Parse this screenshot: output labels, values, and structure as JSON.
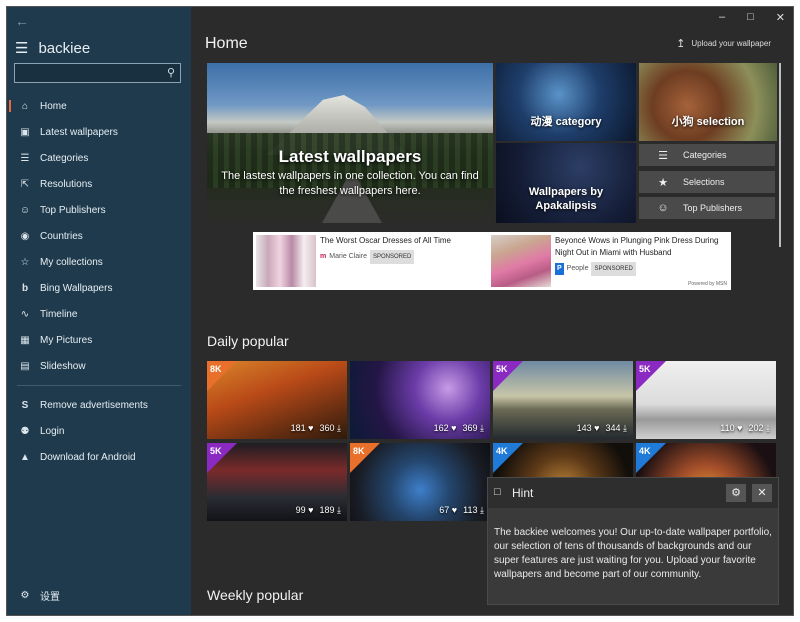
{
  "app": {
    "name": "backiee",
    "page_title": "Home",
    "upload_label": "Upload your wallpaper"
  },
  "search": {
    "placeholder": ""
  },
  "sidebar": {
    "items": [
      {
        "label": "Home",
        "icon": "home-icon"
      },
      {
        "label": "Latest wallpapers",
        "icon": "image-icon"
      },
      {
        "label": "Categories",
        "icon": "list-icon"
      },
      {
        "label": "Resolutions",
        "icon": "resize-icon"
      },
      {
        "label": "Top Publishers",
        "icon": "people-icon"
      },
      {
        "label": "Countries",
        "icon": "globe-icon"
      },
      {
        "label": "My collections",
        "icon": "star-icon"
      },
      {
        "label": "Bing Wallpapers",
        "icon": "bing-icon"
      },
      {
        "label": "Timeline",
        "icon": "timeline-icon"
      },
      {
        "label": "My Pictures",
        "icon": "picture-icon"
      },
      {
        "label": "Slideshow",
        "icon": "slideshow-icon"
      }
    ],
    "extra": [
      {
        "label": "Remove advertisements",
        "icon": "dollar-icon"
      },
      {
        "label": "Login",
        "icon": "user-icon"
      },
      {
        "label": "Download for Android",
        "icon": "android-icon"
      }
    ],
    "settings_label": "设置"
  },
  "hero": {
    "title": "Latest wallpapers",
    "subtitle": "The lastest wallpapers in one collection. You can find the freshest wallpapers here."
  },
  "tiles": {
    "anime": "动漫 category",
    "puppy": "小狗 selection",
    "wallpaper_by": "Wallpapers by Apakalipsis"
  },
  "quick_links": [
    {
      "label": "Categories",
      "icon": "list-icon"
    },
    {
      "label": "Selections",
      "icon": "star-icon"
    },
    {
      "label": "Top Publishers",
      "icon": "people-icon"
    }
  ],
  "ad": {
    "items": [
      {
        "title": "The Worst Oscar Dresses of All Time",
        "source": "Marie Claire",
        "badge": "SPONSORED"
      },
      {
        "title": "Beyoncé Wows in Plunging Pink Dress During Night Out in Miami with Husband",
        "source": "People",
        "badge": "SPONSORED"
      }
    ],
    "powered": "Powered by MSN"
  },
  "sections": {
    "daily": "Daily popular",
    "weekly": "Weekly popular"
  },
  "daily_popular": [
    {
      "badge": "8K",
      "badge_color": "#e8702a",
      "likes": "181",
      "downloads": "360",
      "bg": "linear-gradient(160deg,#d9862a,#b94a18 40%,#5b2a10 80%,#2f1a0c)"
    },
    {
      "badge": "",
      "badge_color": "",
      "likes": "162",
      "downloads": "369",
      "bg": "radial-gradient(circle at 70% 35%,#c79be6 0%,#6b3ca8 30%,#241646 65%,#0c1a36 100%)"
    },
    {
      "badge": "5K",
      "badge_color": "#8b2ac2",
      "likes": "143",
      "downloads": "344",
      "bg": "linear-gradient(180deg,#6f8aa3 0%,#c8c6a8 45%,#6b6a55 62%,#242a2f 100%)"
    },
    {
      "badge": "5K",
      "badge_color": "#8b2ac2",
      "likes": "110",
      "downloads": "202",
      "bg": "linear-gradient(180deg,#f0f0f0 0%,#dcdcdc 55%,#9a9a9a 75%,#cfcfcf 100%)"
    },
    {
      "badge": "5K",
      "badge_color": "#8b2ac2",
      "likes": "99",
      "downloads": "189",
      "bg": "linear-gradient(180deg,#1d1d22 0%,#7a2a2a 35%,#2a2c33 70%,#121318 100%)"
    },
    {
      "badge": "8K",
      "badge_color": "#e8702a",
      "likes": "67",
      "downloads": "113",
      "bg": "radial-gradient(circle at 50% 60%,#3e7fc9 0%,#24466e 35%,#191c24 75%,#0d0f14 100%)"
    },
    {
      "badge": "4K",
      "badge_color": "#1f7ad8",
      "likes": "",
      "downloads": "",
      "bg": "radial-gradient(circle at 50% 60%,#c28a3a 0%,#5e3a18 40%,#120e0a 80%)"
    },
    {
      "badge": "4K",
      "badge_color": "#1f7ad8",
      "likes": "",
      "downloads": "",
      "bg": "radial-gradient(circle at 50% 70%,#e3a330 0%,#a7502a 35%,#1a0f12 80%)"
    }
  ],
  "hint": {
    "title": "Hint",
    "body": "The backiee welcomes you! Our up-to-date wallpaper portfolio, our selection of tens of thousands of backgrounds and our super features are just waiting for you. Upload your favorite wallpapers and become part of our community."
  }
}
